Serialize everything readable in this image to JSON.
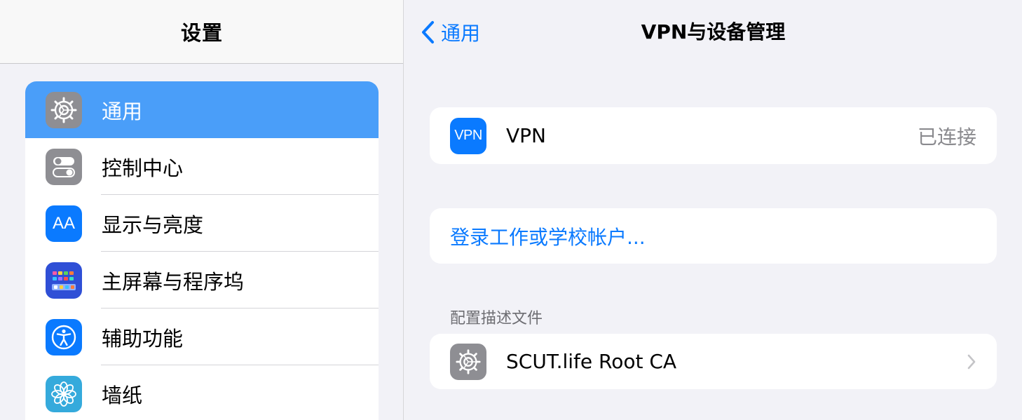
{
  "sidebar": {
    "title": "设置",
    "items": [
      {
        "label": "通用",
        "icon": "gear-icon",
        "selected": true
      },
      {
        "label": "控制中心",
        "icon": "toggle-switches-icon"
      },
      {
        "label": "显示与亮度",
        "icon": "text-size-icon",
        "icon_text": "AA"
      },
      {
        "label": "主屏幕与程序坞",
        "icon": "app-grid-icon"
      },
      {
        "label": "辅助功能",
        "icon": "accessibility-icon"
      },
      {
        "label": "墙纸",
        "icon": "flower-icon"
      }
    ]
  },
  "detail": {
    "back_label": "通用",
    "title": "VPN与设备管理",
    "vpn": {
      "icon_text": "VPN",
      "label": "VPN",
      "status": "已连接"
    },
    "signin_link": "登录工作或学校帐户...",
    "profiles_header": "配置描述文件",
    "profiles": [
      {
        "label": "SCUT.life Root CA",
        "icon": "gear-icon"
      }
    ]
  },
  "colors": {
    "accent": "#0a7aff",
    "selected_row": "#4a9ef9",
    "background": "#f2f2f7"
  }
}
